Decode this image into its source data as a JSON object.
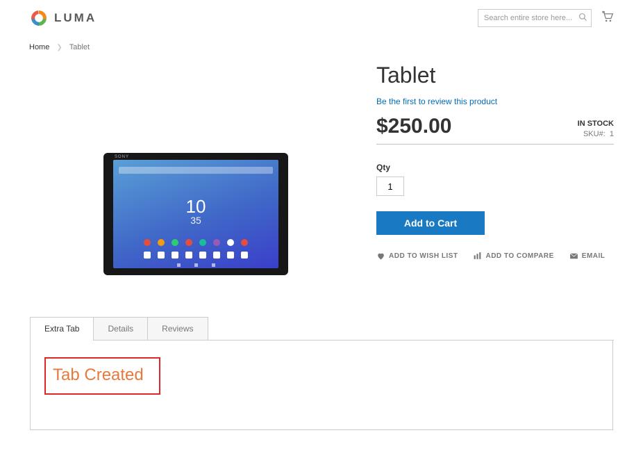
{
  "header": {
    "logo_text": "LUMA",
    "search_placeholder": "Search entire store here..."
  },
  "breadcrumb": {
    "home": "Home",
    "current": "Tablet"
  },
  "product": {
    "name": "Tablet",
    "device_brand": "SONY",
    "device_time_h": "10",
    "device_time_m": "35",
    "review_link": "Be the first to review this product",
    "price": "$250.00",
    "stock_status": "IN STOCK",
    "sku_label": "SKU#:",
    "sku": "1",
    "qty_label": "Qty",
    "qty_value": "1",
    "add_to_cart": "Add to Cart",
    "wishlist": "ADD TO WISH LIST",
    "compare": "ADD TO COMPARE",
    "email": "EMAIL"
  },
  "tabs": [
    {
      "label": "Extra Tab",
      "active": true
    },
    {
      "label": "Details",
      "active": false
    },
    {
      "label": "Reviews",
      "active": false
    }
  ],
  "tab_content": {
    "text": "Tab Created"
  }
}
